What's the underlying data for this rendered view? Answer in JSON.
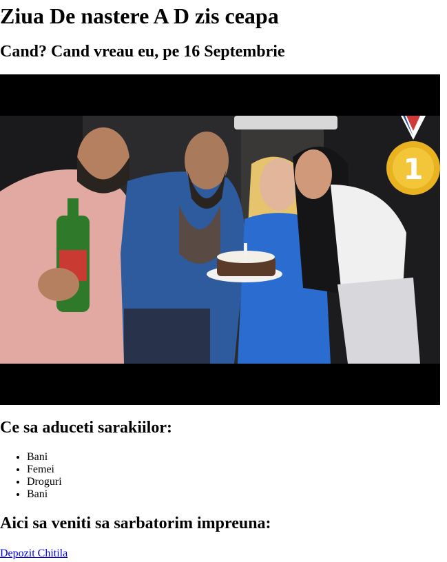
{
  "page": {
    "title": "Ziua De nastere A D zis ceapa",
    "subtitle": "Cand? Cand vreau eu, pe 16 Septembrie"
  },
  "photo": {
    "description_icon": "party-photo",
    "medal_number": "1"
  },
  "bring_section": {
    "heading": "Ce sa aduceti sarakiilor:",
    "items": [
      "Bani",
      "Femei",
      "Droguri",
      "Bani"
    ]
  },
  "venue_section": {
    "heading": "Aici sa veniti sa sarbatorim impreuna:",
    "link_text": "Depozit Chitila"
  },
  "colors": {
    "link": "#0000ee",
    "text": "#000000",
    "letterbox": "#000000"
  }
}
